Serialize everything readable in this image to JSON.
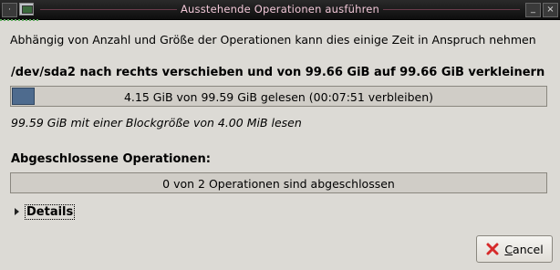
{
  "window": {
    "title": "Ausstehende Operationen ausführen",
    "menu_glyph": "·",
    "minimize_glyph": "_",
    "close_glyph": "×"
  },
  "info_text": "Abhängig von Anzahl und Größe der Operationen kann dies einige Zeit in Anspruch nehmen",
  "operation": {
    "title": "/dev/sda2 nach rechts verschieben und von 99.66 GiB auf 99.66 GiB verkleinern",
    "progress_fraction": 0.042,
    "progress_text": "4.15 GiB von 99.59 GiB gelesen (00:07:51 verbleiben)",
    "detail_text": "99.59 GiB mit einer Blockgröße von 4.00 MiB lesen"
  },
  "completed": {
    "title": "Abgeschlossene Operationen:",
    "progress_fraction": 0,
    "progress_text": "0 von 2 Operationen sind abgeschlossen"
  },
  "details": {
    "label": "Details"
  },
  "cancel_button": {
    "accel": "C",
    "rest": "ancel",
    "icon": "cancel-icon"
  },
  "colors": {
    "progress_fill": "#4e6b8e",
    "title_text": "#f1c7d7",
    "cancel_icon": "#d62b2b"
  }
}
